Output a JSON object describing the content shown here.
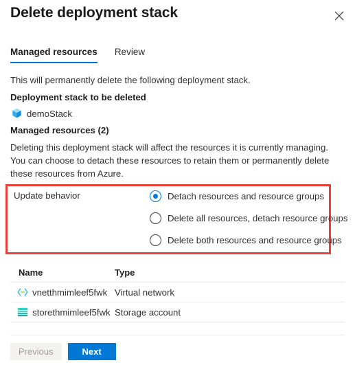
{
  "header": {
    "title": "Delete deployment stack",
    "close_icon": "close-icon"
  },
  "tabs": [
    {
      "label": "Managed resources",
      "active": true
    },
    {
      "label": "Review",
      "active": false
    }
  ],
  "body": {
    "intro_text": "This will permanently delete the following deployment stack.",
    "stack_section_label": "Deployment stack to be deleted",
    "stack_item": {
      "name": "demoStack",
      "icon": "deployment-stack-icon"
    },
    "managed_section_label": "Managed resources (2)",
    "managed_description": "Deleting this deployment stack will affect the resources it is currently managing. You can choose to detach these resources to retain them or permanently delete these resources from Azure."
  },
  "update_behavior": {
    "label": "Update behavior",
    "highlight_color": "#e8413a",
    "options": [
      {
        "label": "Detach resources and resource groups",
        "checked": true
      },
      {
        "label": "Delete all resources, detach resource groups",
        "checked": false
      },
      {
        "label": "Delete both resources and resource groups",
        "checked": false
      }
    ]
  },
  "resources_table": {
    "columns": [
      "Name",
      "Type"
    ],
    "rows": [
      {
        "name": "vnetthmimleef5fwk",
        "type": "Virtual network",
        "icon": "virtual-network-icon"
      },
      {
        "name": "storethmimleef5fwk",
        "type": "Storage account",
        "icon": "storage-account-icon"
      }
    ]
  },
  "footer": {
    "previous_label": "Previous",
    "next_label": "Next",
    "accent_color": "#0078d4"
  }
}
